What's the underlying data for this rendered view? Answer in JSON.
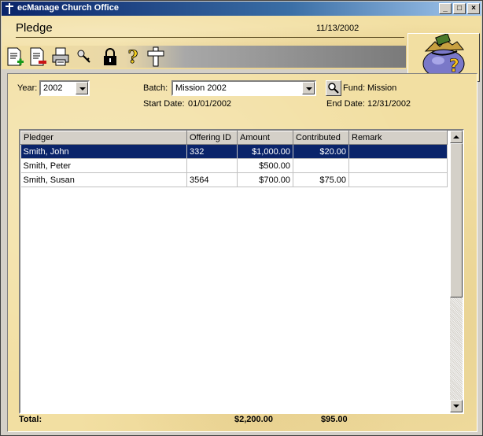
{
  "window": {
    "title": "ecManage Church Office"
  },
  "header": {
    "title": "Pledge",
    "date": "11/13/2002"
  },
  "toolbar": {
    "items": [
      {
        "name": "new-record",
        "icon": "document-add-icon"
      },
      {
        "name": "delete-record",
        "icon": "document-delete-icon"
      },
      {
        "name": "print",
        "icon": "printer-icon"
      },
      {
        "name": "find",
        "icon": "key-icon"
      },
      {
        "name": "lock",
        "icon": "padlock-icon"
      },
      {
        "name": "help",
        "icon": "question-mark-icon"
      },
      {
        "name": "exit",
        "icon": "cross-icon"
      }
    ]
  },
  "filters": {
    "year_label": "Year:",
    "year_value": "2002",
    "batch_label": "Batch:",
    "batch_value": "Mission 2002",
    "fund_label": "Fund:",
    "fund_value": "Mission",
    "start_label": "Start Date:",
    "start_value": "01/01/2002",
    "end_label": "End Date:",
    "end_value": "12/31/2002"
  },
  "grid": {
    "columns": [
      "Pledger",
      "Offering ID",
      "Amount",
      "Contributed",
      "Remark"
    ],
    "rows": [
      {
        "pledger": "Smith, John",
        "offering_id": "332",
        "amount": "$1,000.00",
        "contributed": "$20.00",
        "remark": "",
        "selected": true
      },
      {
        "pledger": "Smith, Peter",
        "offering_id": "",
        "amount": "$500.00",
        "contributed": "",
        "remark": "",
        "selected": false
      },
      {
        "pledger": "Smith, Susan",
        "offering_id": "3564",
        "amount": "$700.00",
        "contributed": "$75.00",
        "remark": "",
        "selected": false
      }
    ]
  },
  "totals": {
    "label": "Total:",
    "amount": "$2,200.00",
    "contributed": "$95.00"
  },
  "colors": {
    "titlebar": "#0a246a",
    "selection": "#0a246a",
    "parchment": "#f2dfa2"
  }
}
